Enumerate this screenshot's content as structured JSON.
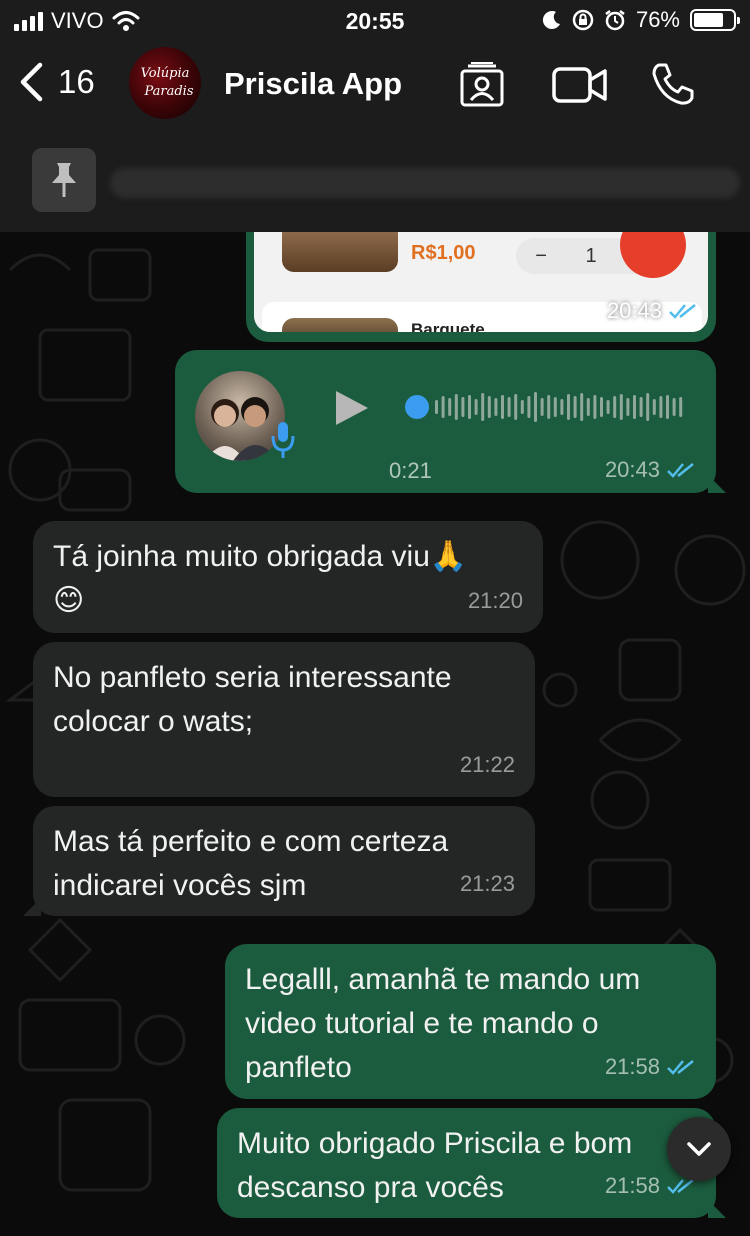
{
  "status": {
    "carrier": "VIVO",
    "time": "20:55",
    "battery": "76%",
    "battery_level": 0.76
  },
  "header": {
    "back_count": "16",
    "avatar_logo_text": "Volúpia Paradis",
    "title": "Priscila App",
    "icons": [
      "contact-card-icon",
      "video-call-icon",
      "phone-icon"
    ]
  },
  "pinned": {
    "icon": "pin-icon"
  },
  "messages": {
    "image_msg": {
      "price": "R$1,00",
      "qty": "1",
      "minus": "−",
      "plus": "+",
      "item_name": "Barguete",
      "time": "20:43"
    },
    "voice_msg": {
      "duration": "0:21",
      "time": "20:43"
    },
    "m1": {
      "line1": "Tá joinha muito obrigada viu🙏",
      "line2": "😊",
      "time": "21:20"
    },
    "m2": {
      "line1": "No panfleto seria interessante",
      "line2": "colocar o wats;",
      "time": "21:22"
    },
    "m3": {
      "line1": "Mas tá perfeito e com certeza",
      "line2": "indicarei vocês sjm",
      "time": "21:23"
    },
    "m4": {
      "line1": "Legalll, amanhã te mando um",
      "line2": "video tutorial e te mando o",
      "line3": "panfleto",
      "time": "21:58"
    },
    "m5": {
      "line1": "Muito obrigado Priscila e bom",
      "line2": "descanso pra vocês",
      "time": "21:58"
    }
  },
  "colors": {
    "outgoing": "#1c5c3e",
    "incoming": "#242626",
    "read_ticks": "#53bdeb"
  }
}
